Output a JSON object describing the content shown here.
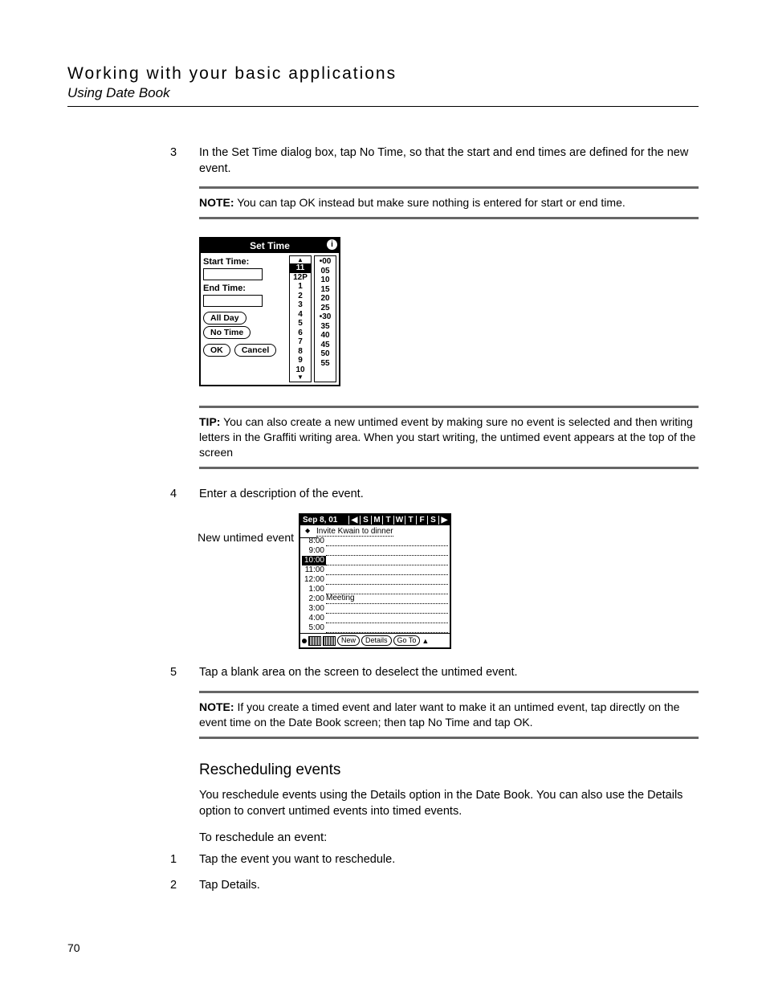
{
  "header": {
    "chapter": "Working with your basic applications",
    "section": "Using Date Book"
  },
  "steps_a": [
    {
      "n": "3",
      "text": "In the Set Time dialog box, tap No Time, so that the start and end times are defined for the new event."
    }
  ],
  "note1": {
    "label": "NOTE:",
    "text": "You can tap OK instead but make sure nothing is entered for start or end time."
  },
  "set_time": {
    "title": "Set Time",
    "start_label": "Start Time:",
    "end_label": "End Time:",
    "all_day": "All Day",
    "no_time": "No Time",
    "ok": "OK",
    "cancel": "Cancel",
    "hours": [
      "11",
      "12P",
      "1",
      "2",
      "3",
      "4",
      "5",
      "6",
      "7",
      "8",
      "9",
      "10"
    ],
    "minutes": [
      "00",
      "05",
      "10",
      "15",
      "20",
      "25",
      "30",
      "35",
      "40",
      "45",
      "50",
      "55"
    ],
    "selected_hour": "11",
    "selected_min_a": "00",
    "selected_min_b": "30"
  },
  "tip1": {
    "label": "TIP:",
    "text": "You can also create a new untimed event by making sure no event is selected and then writing letters in the Graffiti writing area. When you start writing, the untimed event appears at the top of the screen"
  },
  "steps_b": [
    {
      "n": "4",
      "text": "Enter a description of the event."
    }
  ],
  "dayview": {
    "caption": "New untimed event",
    "date": "Sep 8, 01",
    "nav_left": "◀",
    "nav_days": [
      "S",
      "M",
      "T",
      "W",
      "T",
      "F",
      "S"
    ],
    "nav_right": "▶",
    "untimed_event": "Invite Kwain to dinner",
    "rows": [
      {
        "time": "8:00",
        "hl": false,
        "event": ""
      },
      {
        "time": "9:00",
        "hl": false,
        "event": ""
      },
      {
        "time": "10:00",
        "hl": true,
        "event": ""
      },
      {
        "time": "11:00",
        "hl": false,
        "event": ""
      },
      {
        "time": "12:00",
        "hl": false,
        "event": ""
      },
      {
        "time": "1:00",
        "hl": false,
        "event": ""
      },
      {
        "time": "2:00",
        "hl": false,
        "event": "Meeting"
      },
      {
        "time": "3:00",
        "hl": false,
        "event": ""
      },
      {
        "time": "4:00",
        "hl": false,
        "event": ""
      },
      {
        "time": "5:00",
        "hl": false,
        "event": ""
      }
    ],
    "footer": {
      "new": "New",
      "details": "Details",
      "goto": "Go To"
    }
  },
  "steps_c": [
    {
      "n": "5",
      "text": "Tap a blank area on the screen to deselect the untimed event."
    }
  ],
  "note2": {
    "label": "NOTE:",
    "text": "If you create a timed event and later want to make it an untimed event, tap directly on the event time on the Date Book screen; then tap No Time and tap OK."
  },
  "resched": {
    "heading": "Rescheduling events",
    "para": "You reschedule events using the Details option in the Date Book. You can also use the Details option to convert untimed events into timed events.",
    "proc": "To reschedule an event:",
    "steps": [
      {
        "n": "1",
        "text": "Tap the event you want to reschedule."
      },
      {
        "n": "2",
        "text": "Tap Details."
      }
    ]
  },
  "page_number": "70"
}
